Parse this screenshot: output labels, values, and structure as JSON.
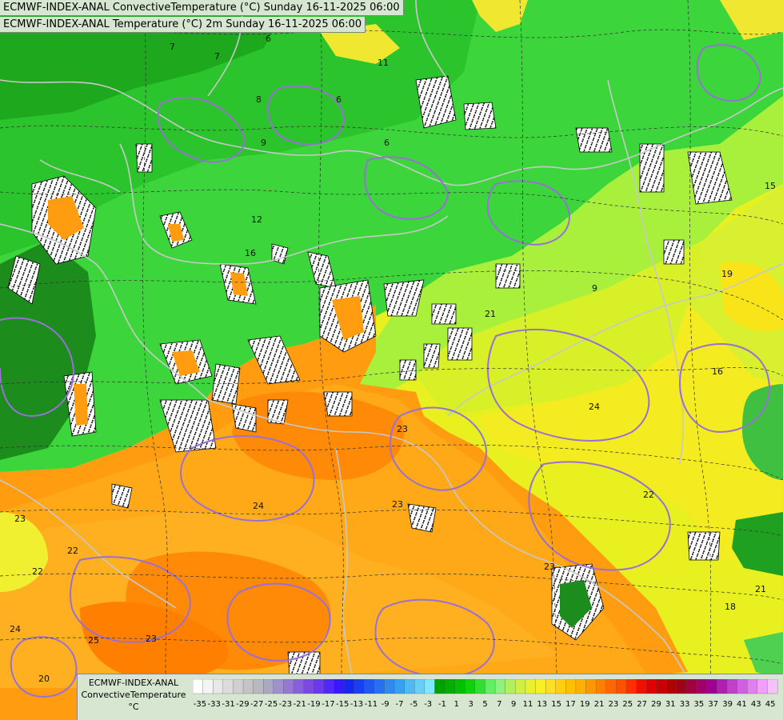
{
  "header": {
    "title_line_1": "ECMWF-INDEX-ANAL ConvectiveTemperature (°C) Sunday 16-11-2025 06:00",
    "title_line_2": "ECMWF-INDEX-ANAL Temperature (°C) 2m Sunday 16-11-2025 06:00"
  },
  "legend": {
    "label_line_1": "ECMWF-INDEX-ANAL",
    "label_line_2": "ConvectiveTemperature",
    "label_line_3": "°C",
    "tick_labels": [
      "-35",
      "-33",
      "-31",
      "-29",
      "-27",
      "-25",
      "-23",
      "-21",
      "-19",
      "-17",
      "-15",
      "-13",
      "-11",
      "-9",
      "-7",
      "-5",
      "-3",
      "-1",
      "1",
      "3",
      "5",
      "7",
      "9",
      "11",
      "13",
      "15",
      "17",
      "19",
      "21",
      "23",
      "25",
      "27",
      "29",
      "31",
      "33",
      "35",
      "37",
      "39",
      "41",
      "43",
      "45"
    ],
    "colors": [
      "#ffffff",
      "#f4f4f4",
      "#e8e8e8",
      "#dcdcdc",
      "#d0d0d0",
      "#c4c4c4",
      "#b8b8c0",
      "#aca8c4",
      "#a090cc",
      "#9478d4",
      "#8860dc",
      "#7c48e4",
      "#6a38f0",
      "#5028f8",
      "#3818f8",
      "#1428f0",
      "#1840f0",
      "#2058f0",
      "#2870f0",
      "#3088f0",
      "#38a0f0",
      "#50b8f4",
      "#68d0f8",
      "#80e8fc",
      "#00a000",
      "#00b000",
      "#00c000",
      "#10d010",
      "#30e030",
      "#60f060",
      "#90f080",
      "#b0f060",
      "#d0f040",
      "#e8f030",
      "#f8f020",
      "#ffe020",
      "#ffd010",
      "#ffc000",
      "#ffb000",
      "#ff9800",
      "#ff8000",
      "#ff6800",
      "#ff5000",
      "#ff3000",
      "#f01000",
      "#e00000",
      "#c80000",
      "#b00000",
      "#a00018",
      "#a00040",
      "#a00068",
      "#a00090",
      "#b020b0",
      "#c040c8",
      "#d060e0",
      "#e080f0",
      "#f0a0f8",
      "#f8c0f8"
    ]
  },
  "map": {
    "contour_labels": [
      "7",
      "7",
      "6",
      "6",
      "8",
      "11",
      "9",
      "6",
      "12",
      "16",
      "9",
      "15",
      "19",
      "16",
      "21",
      "22",
      "23",
      "24",
      "22",
      "23",
      "25",
      "23",
      "22",
      "24",
      "23",
      "18",
      "21",
      "20",
      "24",
      "23"
    ]
  }
}
